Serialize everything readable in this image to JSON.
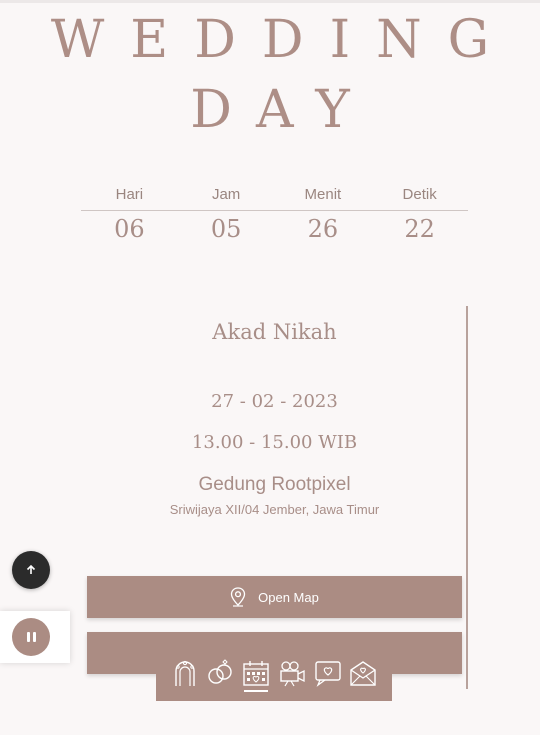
{
  "hero": {
    "line1": "WEDDING",
    "line2": "DAY"
  },
  "countdown": {
    "labels": [
      "Hari",
      "Jam",
      "Menit",
      "Detik"
    ],
    "values": [
      "06",
      "05",
      "26",
      "22"
    ]
  },
  "event": {
    "title": "Akad Nikah",
    "date": "27 - 02 - 2023",
    "time": "13.00 - 15.00 WIB",
    "venue": "Gedung Rootpixel",
    "address": "Sriwijaya XII/04 Jember, Jawa Timur",
    "map_button": "Open Map"
  },
  "nav": {
    "items": [
      "ceremony-arch-icon",
      "rings-icon",
      "calendar-icon",
      "camera-icon",
      "love-chat-icon",
      "love-letter-icon"
    ],
    "active_index": 2
  },
  "controls": {
    "scroll_top_icon": "arrow-up-icon",
    "music_icon": "pause-icon"
  },
  "colors": {
    "accent": "#ab8c83",
    "text": "#a88e88",
    "background": "#faf7f7"
  }
}
